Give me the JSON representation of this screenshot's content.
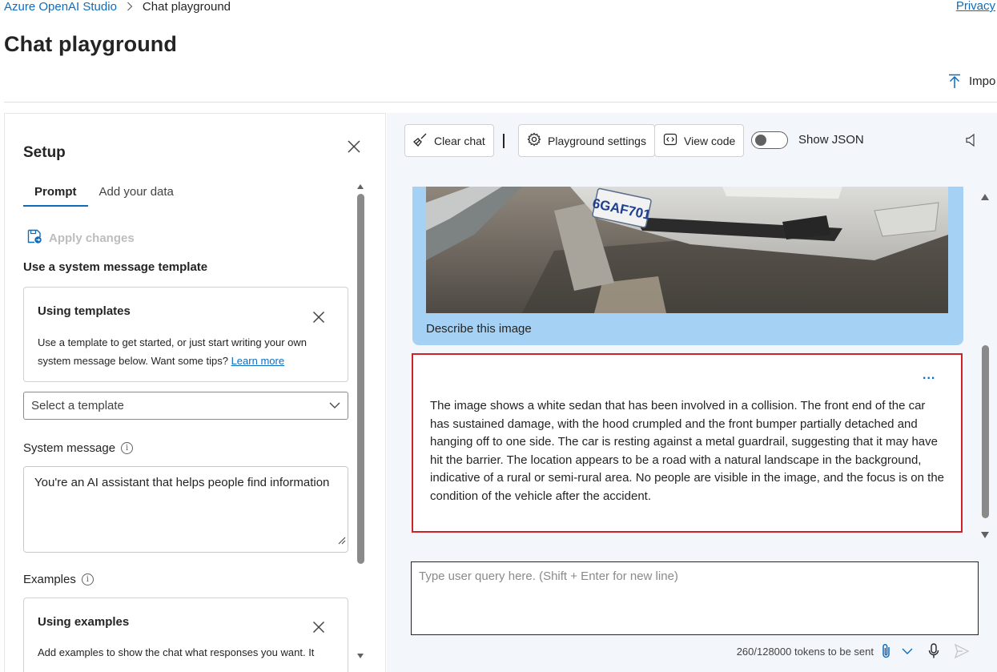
{
  "header": {
    "breadcrumb_root": "Azure OpenAI Studio",
    "breadcrumb_current": "Chat playground",
    "privacy": "Privacy",
    "page_title": "Chat playground",
    "import_label": "Impo"
  },
  "setup": {
    "title": "Setup",
    "tabs": [
      {
        "label": "Prompt",
        "active": true
      },
      {
        "label": "Add your data",
        "active": false
      }
    ],
    "apply_changes": "Apply changes",
    "template_section_label": "Use a system message template",
    "templates_card": {
      "title": "Using templates",
      "body": "Use a template to get started, or just start writing your own system message below. Want some tips?",
      "link": "Learn more"
    },
    "template_select_placeholder": "Select a template",
    "system_message_label": "System message",
    "system_message_value": "You're an AI assistant that helps people find information",
    "examples_label": "Examples",
    "examples_card": {
      "title": "Using examples",
      "body": "Add examples to show the chat what responses you want. It"
    }
  },
  "chat": {
    "toolbar": {
      "clear_chat": "Clear chat",
      "playground_settings": "Playground settings",
      "view_code": "View code",
      "show_json": "Show JSON",
      "show_json_on": false
    },
    "user_message": {
      "plate_text": "6GAF701",
      "text": "Describe this image"
    },
    "assistant_message": {
      "more": "...",
      "text": "The image shows a white sedan that has been involved in a collision. The front end of the car has sustained damage, with the hood crumpled and the front bumper partially detached and hanging off to one side. The car is resting against a metal guardrail, suggesting that it may have hit the barrier. The location appears to be a road with a natural landscape in the background, indicative of a rural or semi-rural area. No people are visible in the image, and the focus is on the condition of the vehicle after the accident."
    },
    "input_placeholder": "Type user query here. (Shift + Enter for new line)",
    "token_count": "260/128000 tokens to be sent"
  },
  "colors": {
    "accent": "#0f6cbd",
    "user_bubble": "#a5d2f4",
    "chat_bg": "#f3f7fc",
    "highlight_border": "#d0202a"
  }
}
